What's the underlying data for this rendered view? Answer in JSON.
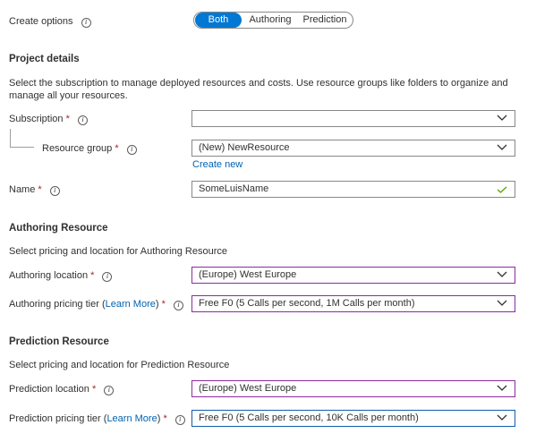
{
  "create_options": {
    "label": "Create options",
    "options": [
      "Both",
      "Authoring",
      "Prediction"
    ],
    "selected": "Both"
  },
  "project_details": {
    "title": "Project details",
    "description": "Select the subscription to manage deployed resources and costs. Use resource groups like folders to organize and manage all your resources.",
    "subscription": {
      "label": "Subscription",
      "value": ""
    },
    "resource_group": {
      "label": "Resource group",
      "value": "(New) NewResource",
      "create_new": "Create new"
    },
    "name": {
      "label": "Name",
      "value": "SomeLuisName"
    }
  },
  "authoring": {
    "title": "Authoring Resource",
    "description": "Select pricing and location for Authoring Resource",
    "location": {
      "label": "Authoring location",
      "value": "(Europe) West Europe"
    },
    "pricing": {
      "label_prefix": "Authoring pricing tier (",
      "learn_more": "Learn More",
      "label_suffix": ")",
      "value": "Free F0 (5 Calls per second, 1M Calls per month)"
    }
  },
  "prediction": {
    "title": "Prediction Resource",
    "description": "Select pricing and location for Prediction Resource",
    "location": {
      "label": "Prediction location",
      "value": "(Europe) West Europe"
    },
    "pricing": {
      "label_prefix": "Prediction pricing tier (",
      "learn_more": "Learn More",
      "label_suffix": ")",
      "value": "Free F0 (5 Calls per second, 10K Calls per month)"
    }
  },
  "common": {
    "required_mark": "*",
    "info_glyph": "i"
  },
  "colors": {
    "accent": "#0078d4",
    "link": "#0063b1",
    "required": "#a4262c",
    "valid": "#57a300",
    "invalid_border": "#8e2aa0"
  }
}
